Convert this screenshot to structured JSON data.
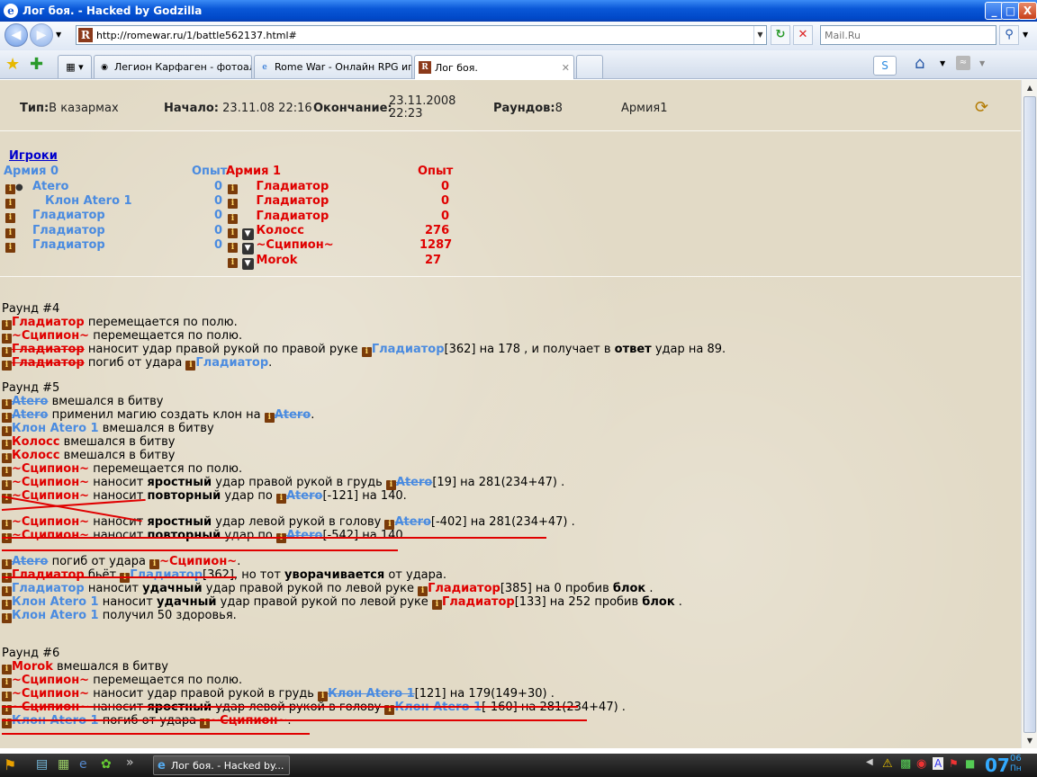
{
  "window": {
    "title": "Лог боя. - Hacked by Godzilla",
    "min": "_",
    "max": "□",
    "close": "X"
  },
  "nav": {
    "url": "http://romewar.ru/1/battle562137.html#",
    "search_placeholder": "Mail.Ru"
  },
  "tabs": [
    {
      "label": "Легион Карфаген - фотоал..."
    },
    {
      "label": "Rome War - Онлайн RPG иг..."
    },
    {
      "label": "Лог боя."
    }
  ],
  "header": {
    "type_label": "Тип:",
    "type_value": "В казармах",
    "start_label": "Начало:",
    "start_value": "23.11.08 22:16",
    "end_label": "Окончание:",
    "end_value1": "23.11.2008",
    "end_value2": "22:23",
    "rounds_label": "Раундов:",
    "rounds_value": "8",
    "army": "Армия1"
  },
  "players": {
    "title": "Игроки",
    "army0": "Армия 0",
    "army1": "Армия 1",
    "exp": "Опыт",
    "left": [
      {
        "name": "Atero",
        "exp": "0"
      },
      {
        "name": "Клон Atero 1",
        "exp": "0"
      },
      {
        "name": "Гладиатор",
        "exp": "0"
      },
      {
        "name": "Гладиатор",
        "exp": "0"
      },
      {
        "name": "Гладиатор",
        "exp": "0"
      }
    ],
    "right": [
      {
        "name": "Гладиатор",
        "exp": "0"
      },
      {
        "name": "Гладиатор",
        "exp": "0"
      },
      {
        "name": "Гладиатор",
        "exp": "0"
      },
      {
        "name": "Колосс",
        "exp": "276"
      },
      {
        "name": "~Сципион~",
        "exp": "1287"
      },
      {
        "name": "Morok",
        "exp": "27"
      }
    ]
  },
  "log": {
    "r4": "Раунд #4",
    "r5": "Раунд #5",
    "r6": "Раунд #6",
    "t_move": "перемещается по полю.",
    "t_joined": "вмешался в битву",
    "t_died": "погиб от удара",
    "t_magic": "применил магию создать клон на",
    "t_hits": "наносит",
    "t_fierce": "яростный",
    "t_repeat": "повторный",
    "t_lucky": "удачный",
    "t_answer": "ответ",
    "l4_3a": "наносит удар правой рукой по правой руке",
    "l4_3b": "[362] на 178 , и получает в",
    "l4_3c": "удар на 89.",
    "l5_8": "удар правой рукой в грудь",
    "l5_8b": "[19] на 281(234+47) .",
    "l5_9": "удар по",
    "l5_9b": "[-121] на 140.",
    "l5_10": "удар левой рукой в голову",
    "l5_10b": "[-402] на 281(234+47) .",
    "l5_11b": "[-542] на 140.",
    "l5_13a": "бьёт",
    "l5_13b": "[362], но тот",
    "l5_13c": "уворачивается",
    "l5_13d": "от удара.",
    "l5_14": "удар правой рукой по левой руке",
    "l5_14b": "[385] на 0 пробив",
    "block": "блок",
    "l5_15b": "[133] на 252 пробив",
    "l5_16": "получил 50 здоровья.",
    "l6_3": "наносит удар правой рукой в грудь",
    "l6_3b": "[121] на 179(149+30) .",
    "l6_4b": "[-160] на 281(234+47) ."
  },
  "taskbar": {
    "task": "Лог боя. - Hacked by...",
    "clock": "07",
    "clock_sup": "06",
    "clock_day": "Пн"
  }
}
